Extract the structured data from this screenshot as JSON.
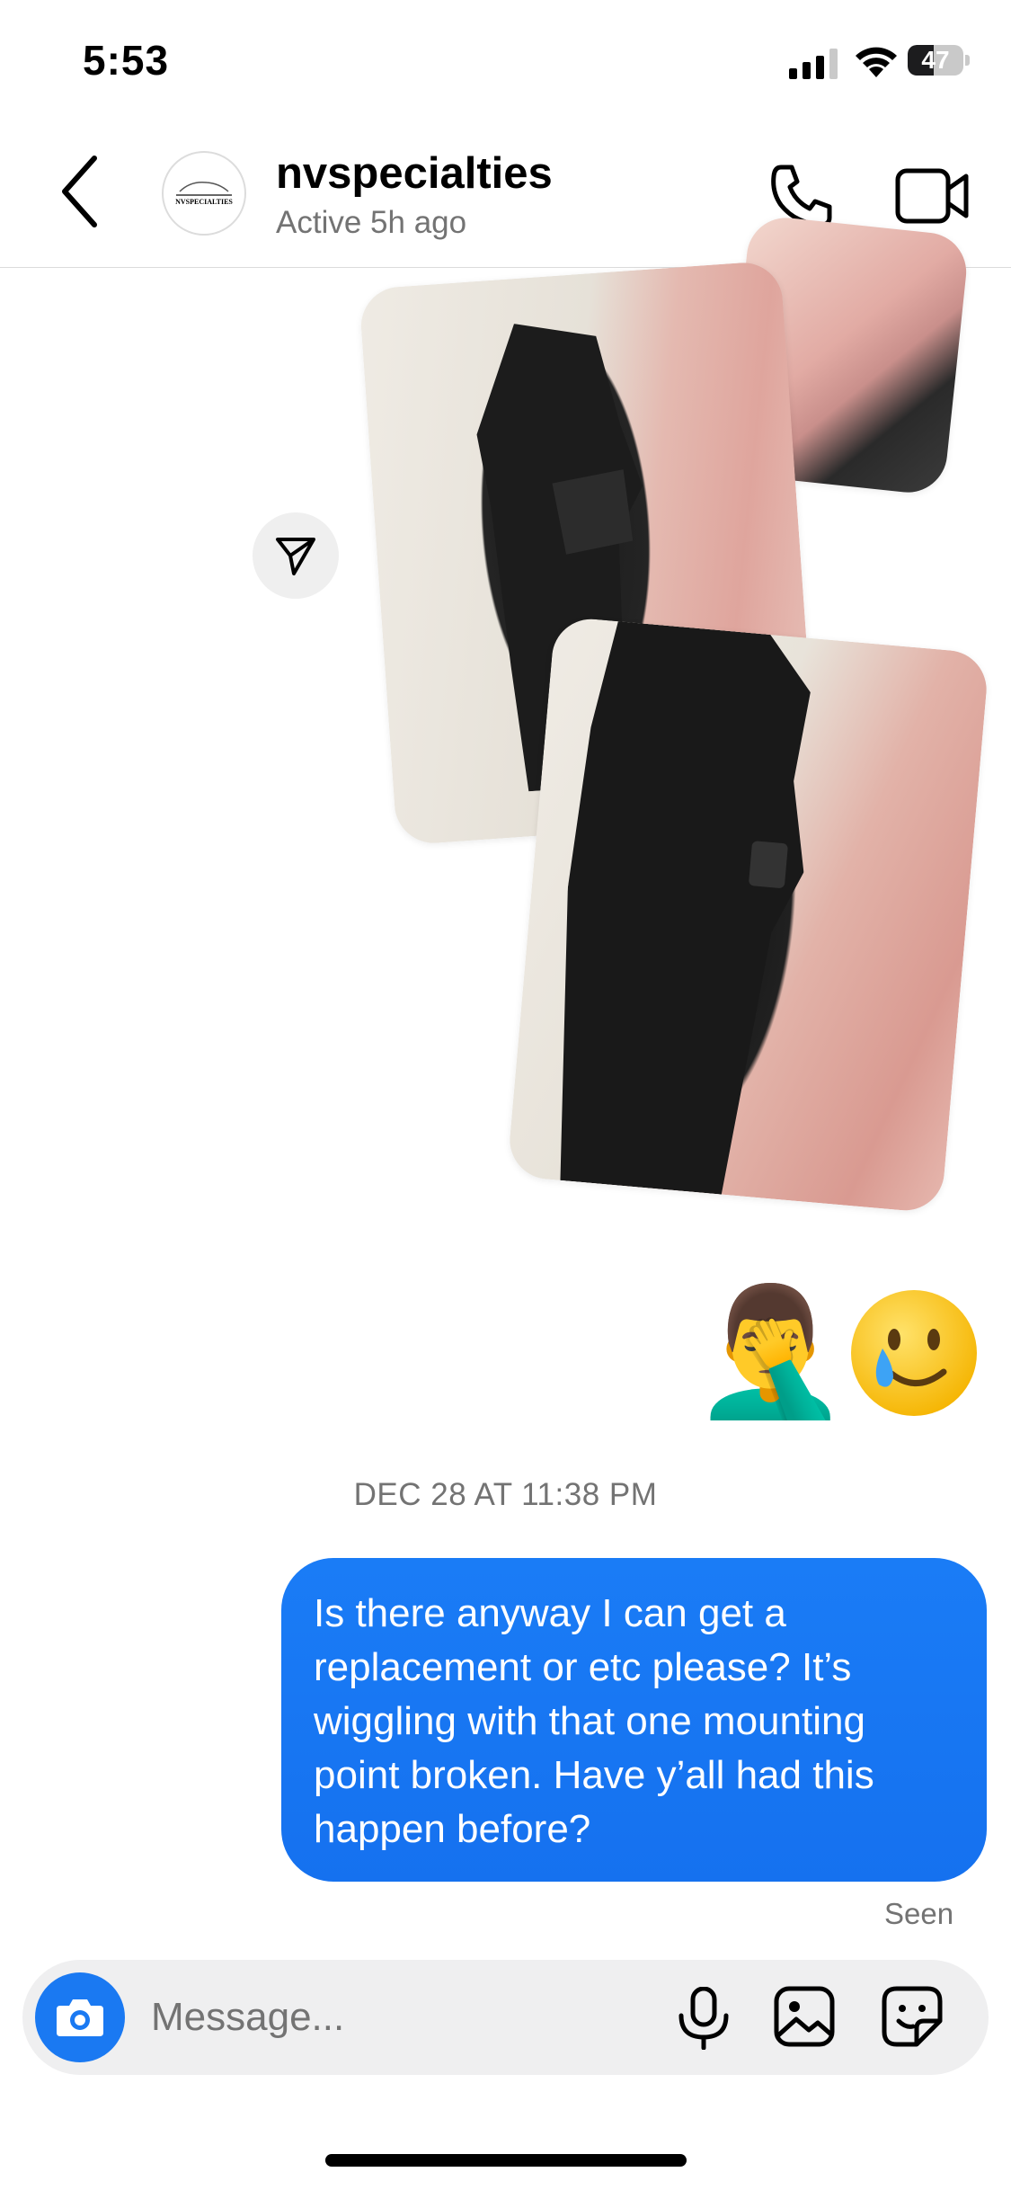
{
  "status_bar": {
    "time": "5:53",
    "battery": "47",
    "battery_level": 0.47
  },
  "header": {
    "username": "nvspecialties",
    "activity": "Active 5h ago",
    "avatar_logo_text": "NVSPECIALTIES"
  },
  "icons": {
    "back": "chevron-left-icon",
    "call": "phone-icon",
    "video": "video-camera-icon",
    "share": "paper-plane-icon",
    "camera": "camera-icon",
    "mic": "microphone-icon",
    "gallery": "image-icon",
    "sticker": "sticker-icon"
  },
  "conversation": {
    "emojis": [
      "🤦‍♂️",
      "🥲"
    ],
    "timestamp": "DEC 28 AT 11:38 PM",
    "outgoing_message": "Is there anyway I can get a\nreplacement or etc please?  It’s\nwiggling with that one mounting\npoint broken.  Have y’all had this\nhappen before?",
    "seen_label": "Seen"
  },
  "composer": {
    "placeholder": "Message..."
  },
  "colors": {
    "accent_blue": "#1a79f2",
    "secondary_text": "#737373",
    "composer_bg": "#efeff0"
  }
}
